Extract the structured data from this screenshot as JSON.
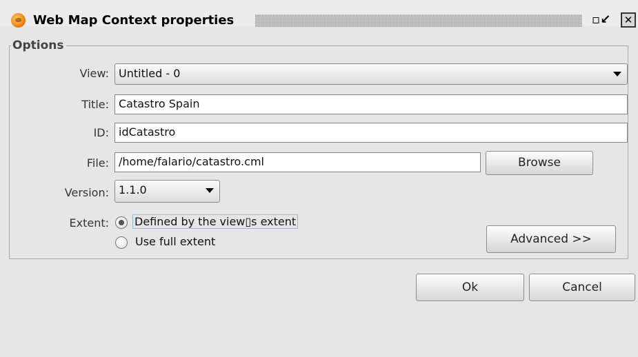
{
  "window": {
    "title": "Web Map Context properties",
    "minimize_glyph": "▫↙",
    "close_glyph": "✕"
  },
  "options": {
    "legend": "Options",
    "view": {
      "label": "View:",
      "value": "Untitled - 0"
    },
    "title": {
      "label": "Title:",
      "value": "Catastro Spain"
    },
    "id": {
      "label": "ID:",
      "value": "idCatastro"
    },
    "file": {
      "label": "File:",
      "value": "/home/falario/catastro.cml",
      "browse_label": "Browse"
    },
    "version": {
      "label": "Version:",
      "value": "1.1.0"
    },
    "extent": {
      "label": "Extent:",
      "option1": "Defined by the view▯s extent",
      "option2": "Use full extent",
      "selected": "option1"
    },
    "advanced_label": "Advanced >>"
  },
  "footer": {
    "ok_label": "Ok",
    "cancel_label": "Cancel"
  },
  "icons": {
    "app": "gvsig-app-icon",
    "dropdown": "chevron-down-icon"
  }
}
